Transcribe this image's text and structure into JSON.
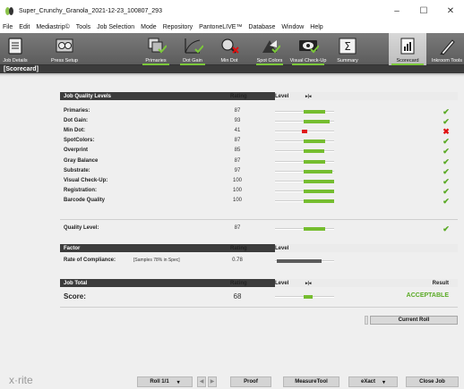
{
  "window": {
    "title": "Super_Crunchy_Granola_2021-12-23_100807_293",
    "minimize": "–",
    "maximize": "☐",
    "close": "✕"
  },
  "menu": [
    "File",
    "Edit",
    "Mediastrip©",
    "Tools",
    "Job Selection",
    "Mode",
    "Repository",
    "PantoneLIVE™",
    "Database",
    "Window",
    "Help"
  ],
  "toolbar": {
    "job_details": "Job Details",
    "press_setup": "Press Setup",
    "primaries": "Primaries",
    "dot_gain": "Dot Gain",
    "min_dot": "Min Dot",
    "spot_colors": "Spot Colors",
    "visual_checkup": "Visual Check-Up",
    "summary": "Summary",
    "scorecard": "Scorecard",
    "inkroom_tools": "Inkroom Tools"
  },
  "section_title": "[Scorecard]",
  "job_quality": {
    "header": "Job Quality Levels",
    "rating_header": "Rating",
    "level_header": "Level",
    "marker": "▸|◂",
    "rows": [
      {
        "name": "Primaries:",
        "rating": "87",
        "level": 0.87,
        "status": "ok"
      },
      {
        "name": "Dot Gain:",
        "rating": "93",
        "level": 0.93,
        "status": "ok"
      },
      {
        "name": "Min Dot:",
        "rating": "41",
        "level": 0.41,
        "status": "fail"
      },
      {
        "name": "SpotColors:",
        "rating": "87",
        "level": 0.87,
        "status": "ok"
      },
      {
        "name": "Overprint",
        "rating": "85",
        "level": 0.85,
        "status": "ok"
      },
      {
        "name": "Gray Balance",
        "rating": "87",
        "level": 0.87,
        "status": "ok"
      },
      {
        "name": "Substrate:",
        "rating": "97",
        "level": 0.97,
        "status": "ok"
      },
      {
        "name": "Visual Check-Up:",
        "rating": "100",
        "level": 1.0,
        "status": "ok"
      },
      {
        "name": "Registration:",
        "rating": "100",
        "level": 1.0,
        "status": "ok"
      },
      {
        "name": "Barcode Quality",
        "rating": "100",
        "level": 1.0,
        "status": "ok"
      }
    ],
    "quality_level": {
      "name": "Quality Level:",
      "rating": "87",
      "level": 0.87,
      "status": "ok"
    }
  },
  "factor": {
    "header": "Factor",
    "rating_header": "Rating",
    "level_header": "Level",
    "row": {
      "name": "Rate of Compliance:",
      "note": "[Samples 78% in Spec]",
      "rating": "0.78",
      "level": 0.78
    }
  },
  "job_total": {
    "header": "Job Total",
    "rating_header": "Rating",
    "level_header": "Level",
    "marker": "▸|◂",
    "result_header": "Result",
    "score_label": "Score:",
    "score": "68",
    "level": 0.68,
    "result": "ACCEPTABLE"
  },
  "current_roll_button": "Current Roll",
  "bottom": {
    "brand": "x·rite",
    "roll": "Roll 1/1",
    "roll_dropdown": "▾",
    "prev": "◀",
    "next": "▶",
    "proof": "Proof",
    "measure_tool": "MeasureTool",
    "exact": "eXact",
    "exact_dropdown": "▾",
    "close_job": "Close Job"
  },
  "colors": {
    "ok": "#5aaa25",
    "fail": "#e01010",
    "bar_green": "#75bd2f",
    "bar_red": "#e01919",
    "header_dark": "#3c3c3c"
  }
}
